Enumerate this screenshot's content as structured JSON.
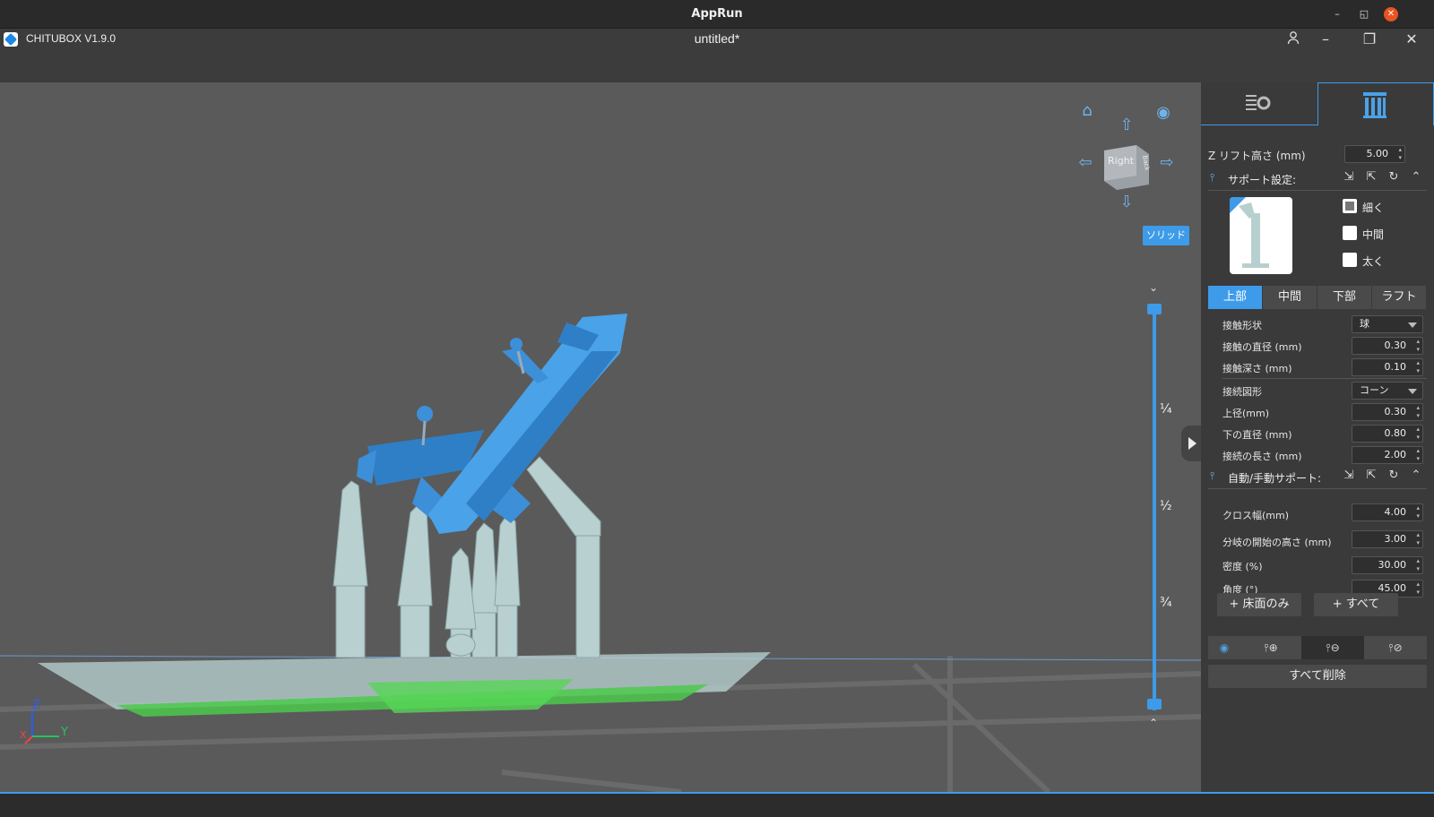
{
  "os": {
    "title": "AppRun",
    "minimize": "–",
    "restore": "◱",
    "close": "✕"
  },
  "app": {
    "name": "CHITUBOX V1.9.0",
    "document": "untitled*",
    "user_icon": "user-icon",
    "minimize_icon": "–",
    "restore_icon": "❐",
    "close_icon": "✕"
  },
  "viewport": {
    "view_cube_label": "Right",
    "view_cube_side": "Back",
    "render_mode": "ソリッド",
    "layer_marks": [
      "¼",
      "½",
      "¾"
    ],
    "axes": {
      "x": "X",
      "y": "Y",
      "z": "Z"
    }
  },
  "panel": {
    "tabs": [
      "settings-tab",
      "support-tab"
    ],
    "z_lift": {
      "label": "Z リフト高さ (mm)",
      "value": "5.00"
    },
    "support_settings": {
      "title": "サポート設定:",
      "presets": [
        {
          "label": "細く",
          "checked": true
        },
        {
          "label": "中間",
          "checked": false
        },
        {
          "label": "太く",
          "checked": false
        }
      ],
      "segments": [
        "上部",
        "中間",
        "下部",
        "ラフト"
      ],
      "active_segment": "上部",
      "rows": {
        "contact_shape": {
          "label": "接触形状",
          "value": "球"
        },
        "contact_diameter": {
          "label": "接触の直径 (mm)",
          "value": "0.30"
        },
        "contact_depth": {
          "label": "接触深さ (mm)",
          "value": "0.10"
        },
        "connection_shape": {
          "label": "接続図形",
          "value": "コーン"
        },
        "upper_diameter": {
          "label": "上径(mm)",
          "value": "0.30"
        },
        "lower_diameter": {
          "label": "下の直径 (mm)",
          "value": "0.80"
        },
        "connection_length": {
          "label": "接続の長さ (mm)",
          "value": "2.00"
        }
      }
    },
    "auto_support": {
      "title": "自動/手動サポート:",
      "rows": {
        "cross_width": {
          "label": "クロス幅(mm)",
          "value": "4.00"
        },
        "branch_height": {
          "label": "分岐の開始の高さ (mm)",
          "value": "3.00"
        },
        "density": {
          "label": "密度 (%)",
          "value": "30.00"
        },
        "angle": {
          "label": "角度 (°)",
          "value": "45.00"
        }
      },
      "buttons": {
        "floor_only": "+ 床面のみ",
        "all": "+ すべて"
      },
      "delete_all": "すべて削除"
    }
  },
  "colors": {
    "accent": "#3d9be9",
    "model": "#3d8fd8",
    "support": "#a8c6c6",
    "viewport": "#5a5a5a",
    "panel": "#3a3a3a"
  }
}
